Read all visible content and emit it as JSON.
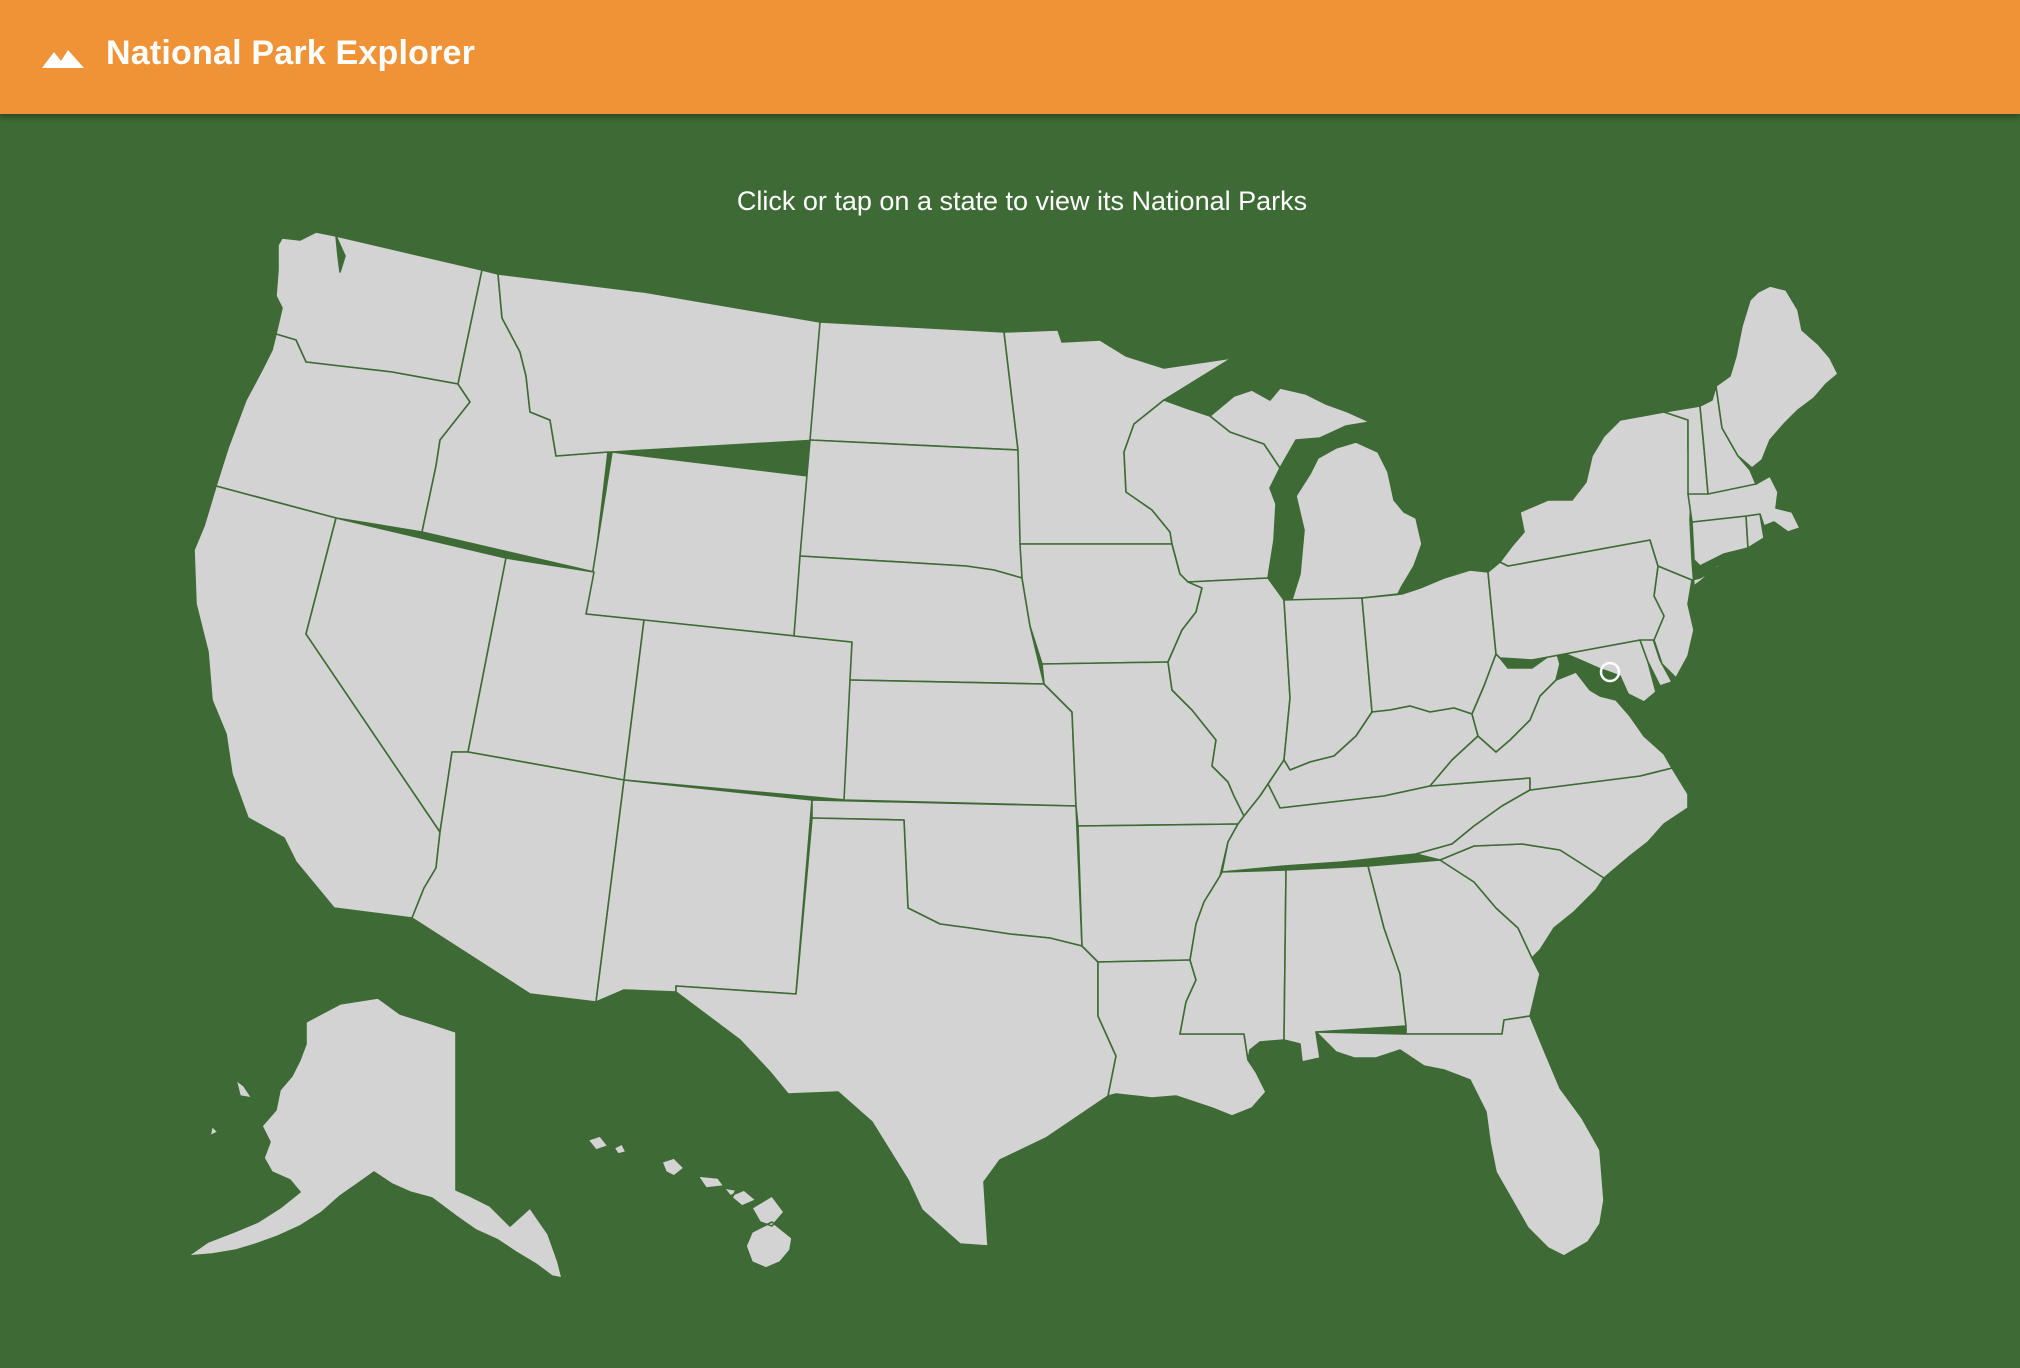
{
  "app": {
    "title": "National Park Explorer",
    "logo_icon": "mountain-icon"
  },
  "main": {
    "instruction": "Click or tap on a state to view its National Parks"
  },
  "colors": {
    "appbar": "#f09236",
    "background": "#3e6b35",
    "state_fill": "#d3d3d3",
    "state_border": "#3e6b35"
  },
  "map": {
    "states": [
      "Washington",
      "Oregon",
      "California",
      "Idaho",
      "Nevada",
      "Montana",
      "Wyoming",
      "Utah",
      "Arizona",
      "Colorado",
      "New Mexico",
      "North Dakota",
      "South Dakota",
      "Nebraska",
      "Kansas",
      "Oklahoma",
      "Texas",
      "Minnesota",
      "Iowa",
      "Missouri",
      "Arkansas",
      "Louisiana",
      "Wisconsin",
      "Illinois",
      "Michigan",
      "Indiana",
      "Ohio",
      "Kentucky",
      "Tennessee",
      "Mississippi",
      "Alabama",
      "Georgia",
      "Florida",
      "South Carolina",
      "North Carolina",
      "Virginia",
      "West Virginia",
      "Maryland",
      "Delaware",
      "New Jersey",
      "Pennsylvania",
      "New York",
      "Connecticut",
      "Rhode Island",
      "Massachusetts",
      "Vermont",
      "New Hampshire",
      "Maine",
      "District of Columbia",
      "Alaska",
      "Hawaii"
    ]
  }
}
